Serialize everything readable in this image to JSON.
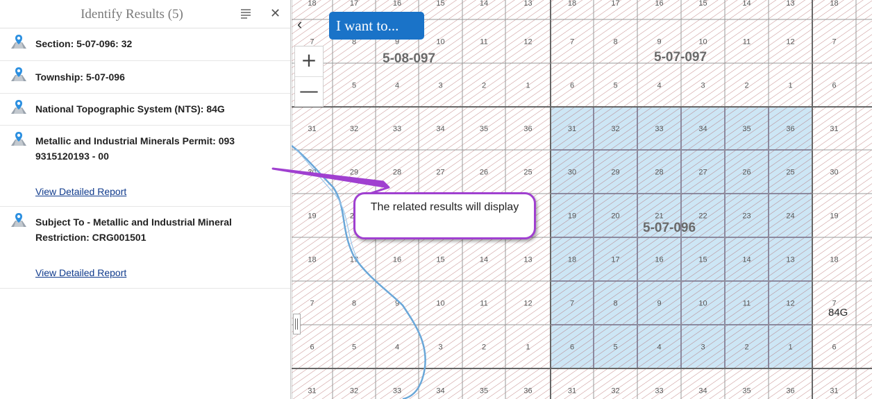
{
  "panel": {
    "title": "Identify Results (5)",
    "results": [
      {
        "text": "Section: 5-07-096: 32"
      },
      {
        "text": "Township: 5-07-096"
      },
      {
        "text": "National Topographic System (NTS): 84G"
      },
      {
        "line1": "Metallic and Industrial Minerals Permit: 093",
        "line2": "9315120193 - 00",
        "link": "View Detailed Report"
      },
      {
        "line1": "Subject To - Metallic and Industrial Mineral",
        "line2": "Restriction: CRG001501",
        "link": "View Detailed Report"
      }
    ]
  },
  "map": {
    "iwant_label": "I want to...",
    "zoom_in": "+",
    "zoom_out": "—",
    "collapse": "‹",
    "callout": "The related results will display",
    "township_labels": [
      "5-08-097",
      "5-07-097",
      "5-07-096"
    ],
    "nts_label": "84G",
    "highlight_color": "#cde6f5",
    "callout_color": "#a040d0",
    "button_color": "#1a73c8"
  }
}
